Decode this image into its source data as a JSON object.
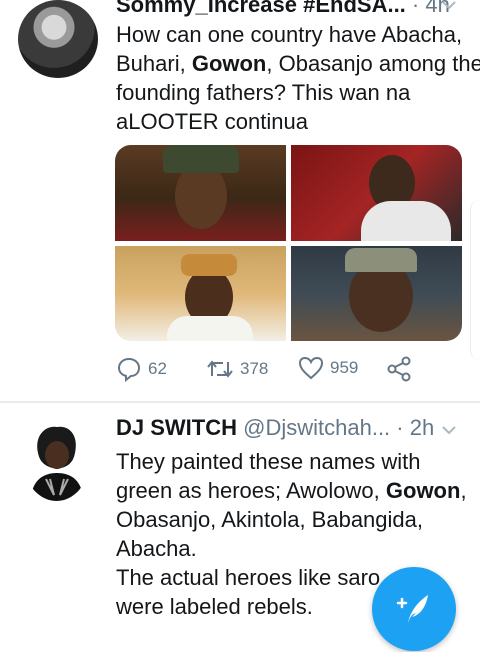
{
  "tweets": [
    {
      "author_name": "Sommy_Increase #EndSA...",
      "dot": "·",
      "time": "4h",
      "text_lines": [
        [
          {
            "t": "How can one country have Abacha,"
          }
        ],
        [
          {
            "t": "Buhari, "
          },
          {
            "t": "Gowon",
            "b": true
          },
          {
            "t": ", Obasanjo among the"
          }
        ],
        [
          {
            "t": "founding fathers? This wan na"
          }
        ],
        [
          {
            "t": "aLOOTER continua"
          }
        ]
      ],
      "actions": {
        "replies": "62",
        "retweets": "378",
        "likes": "959"
      }
    },
    {
      "author_name": "DJ SWITCH",
      "handle": "@Djswitchah...",
      "dot": "·",
      "time": "2h",
      "text_lines": [
        [
          {
            "t": "They painted these names with"
          }
        ],
        [
          {
            "t": "green as heroes; Awolowo, "
          },
          {
            "t": "Gowon",
            "b": true
          },
          {
            "t": ","
          }
        ],
        [
          {
            "t": "Obasanjo, Akintola, Babangida,"
          }
        ],
        [
          {
            "t": "Abacha."
          }
        ],
        [
          {
            "t": " "
          }
        ],
        [
          {
            "t": "The actual heroes like saro"
          }
        ],
        [
          {
            "t": "were labeled rebels."
          }
        ]
      ]
    }
  ],
  "icons": {
    "reply": "reply-icon",
    "retweet": "retweet-icon",
    "like": "like-icon",
    "share": "share-icon",
    "caret": "chevron-down-icon",
    "compose": "compose-tweet-icon"
  },
  "colors": {
    "accent": "#1da1f2",
    "muted": "#657786",
    "text": "#14171a",
    "divider": "#e6ecf0"
  }
}
